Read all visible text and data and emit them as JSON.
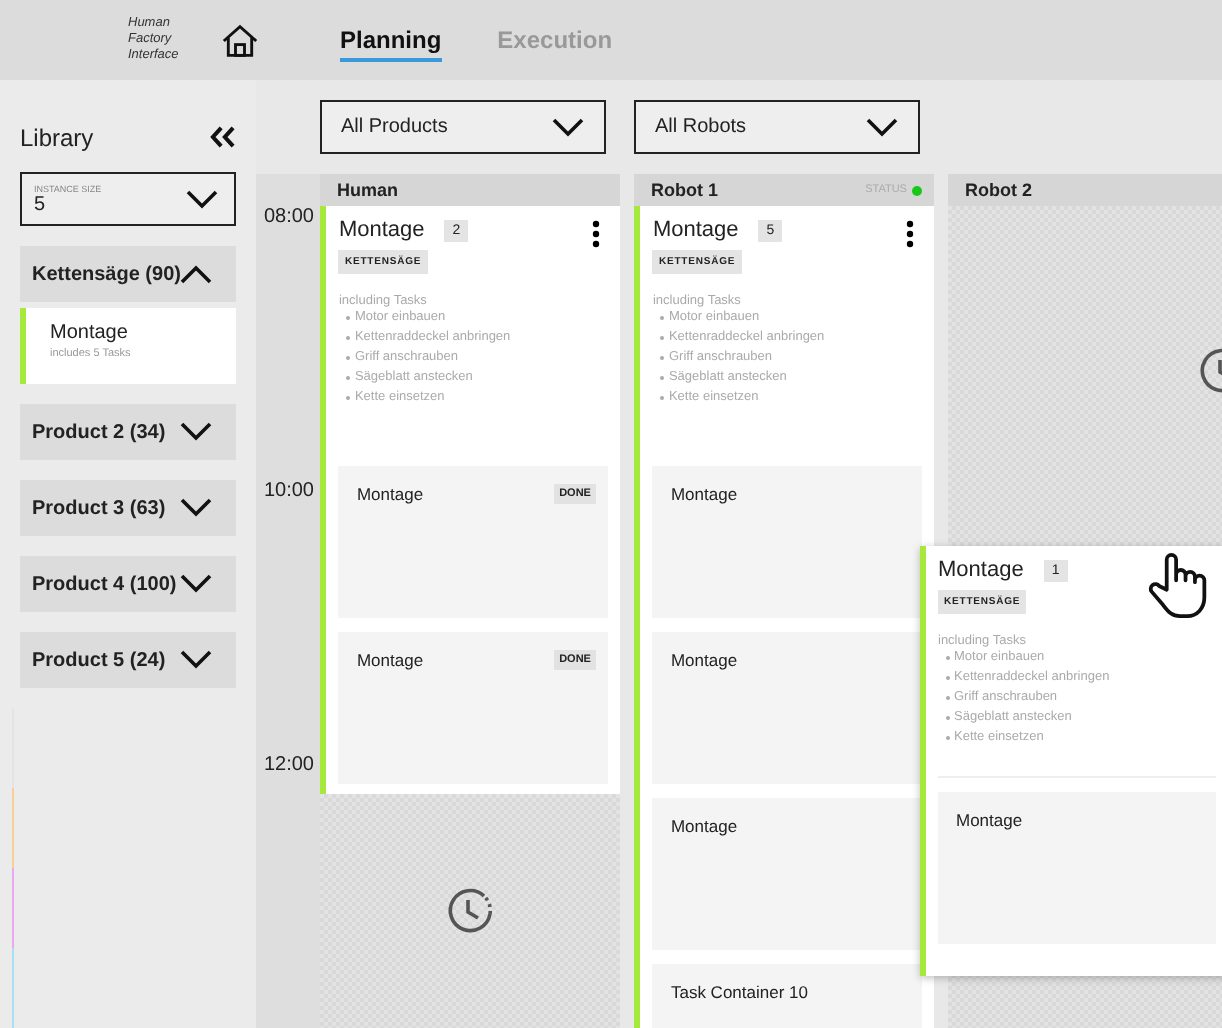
{
  "header": {
    "logo_lines": [
      "Human",
      "Factory",
      "Interface"
    ],
    "tabs": [
      {
        "label": "Planning",
        "selected": true
      },
      {
        "label": "Execution",
        "selected": false
      }
    ]
  },
  "sidebar": {
    "title": "Library",
    "instance_size": {
      "label": "INSTANCE SIZE",
      "value": "5"
    },
    "groups": [
      {
        "label": "Kettensäge (90)",
        "expanded": true,
        "items": [
          {
            "title": "Montage",
            "subtitle": "includes 5 Tasks"
          }
        ]
      },
      {
        "label": "Product 2 (34)",
        "expanded": false
      },
      {
        "label": "Product 3 (63)",
        "expanded": false
      },
      {
        "label": "Product 4 (100)",
        "expanded": false
      },
      {
        "label": "Product 5 (24)",
        "expanded": false
      }
    ],
    "color_strips": [
      {
        "color": "#e4e4e4"
      },
      {
        "color": "#f7cf98"
      },
      {
        "color": "#eaa8f2"
      },
      {
        "color": "#a8e2f2"
      }
    ]
  },
  "filters": [
    {
      "value": "All Products"
    },
    {
      "value": "All Robots"
    }
  ],
  "times": [
    "08:00",
    "10:00",
    "12:00"
  ],
  "columns": [
    {
      "name": "Human",
      "cards": [
        {
          "kind": "job",
          "title": "Montage",
          "count": "2",
          "tag": "KETTENSÄGE",
          "tasks_heading": "including Tasks",
          "tasks": [
            "Motor einbauen",
            "Kettenraddeckel anbringen",
            "Griff anschrauben",
            "Sägeblatt anstecken",
            "Kette einsetzen"
          ],
          "subtasks": [
            {
              "title": "Montage",
              "badge": "DONE"
            },
            {
              "title": "Montage",
              "badge": "DONE"
            }
          ]
        },
        {
          "kind": "empty"
        }
      ]
    },
    {
      "name": "Robot 1",
      "status": {
        "label": "STATUS",
        "online": true
      },
      "cards": [
        {
          "kind": "job",
          "title": "Montage",
          "count": "5",
          "tag": "KETTENSÄGE",
          "tasks_heading": "including Tasks",
          "tasks": [
            "Motor einbauen",
            "Kettenraddeckel anbringen",
            "Griff anschrauben",
            "Sägeblatt anstecken",
            "Kette einsetzen"
          ],
          "subtasks": [
            {
              "title": "Montage"
            },
            {
              "title": "Montage"
            },
            {
              "title": "Montage"
            },
            {
              "title": "Task Container 10"
            }
          ]
        }
      ]
    },
    {
      "name": "Robot 2",
      "cards": [
        {
          "kind": "empty"
        }
      ]
    }
  ],
  "dragged_card": {
    "title": "Montage",
    "count": "1",
    "tag": "KETTENSÄGE",
    "tasks_heading": "including Tasks",
    "tasks": [
      "Motor einbauen",
      "Kettenraddeckel anbringen",
      "Griff anschrauben",
      "Sägeblatt anstecken",
      "Kette einsetzen"
    ],
    "subtasks": [
      {
        "title": "Montage"
      }
    ]
  }
}
